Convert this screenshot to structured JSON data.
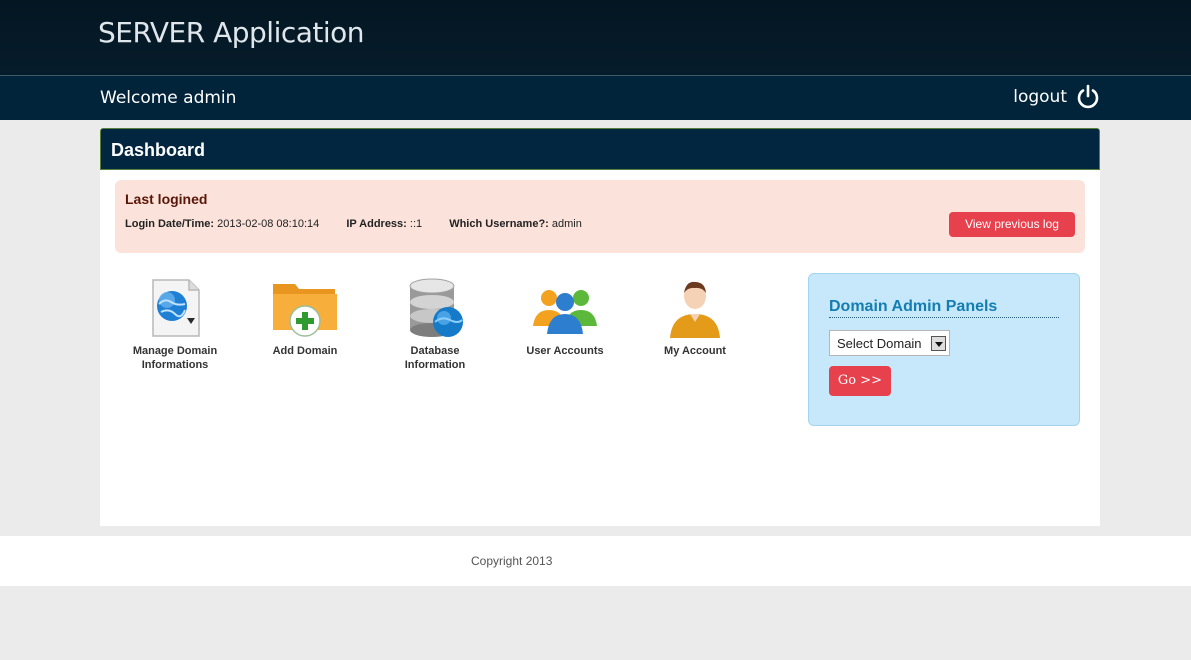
{
  "header": {
    "app_title": "SERVER Application"
  },
  "userbar": {
    "welcome": "Welcome admin",
    "logout_label": "logout",
    "logout_icon": "power-icon"
  },
  "dashboard": {
    "title": "Dashboard",
    "last_login": {
      "title": "Last logined",
      "date_label": "Login Date/Time:",
      "date_value": "2013-02-08 08:10:14",
      "ip_label": "IP Address:",
      "ip_value": "::1",
      "user_label": "Which Username?:",
      "user_value": "admin",
      "view_log_button": "View previous log"
    },
    "tiles": [
      {
        "label_line1": "Manage Domain",
        "label_line2": "Informations",
        "icon": "globe-document-icon"
      },
      {
        "label_line1": "Add Domain",
        "label_line2": "",
        "icon": "folder-add-icon"
      },
      {
        "label_line1": "Database",
        "label_line2": "Information",
        "icon": "database-globe-icon"
      },
      {
        "label_line1": "User Accounts",
        "label_line2": "",
        "icon": "users-icon"
      },
      {
        "label_line1": "My Account",
        "label_line2": "",
        "icon": "user-icon"
      }
    ],
    "domain_panel": {
      "title": "Domain Admin Panels",
      "select_value": "Select Domain",
      "go_button": "Go >>"
    }
  },
  "footer": {
    "copyright": "Copyright 2013"
  },
  "colors": {
    "header_bg": "#041622",
    "userbar_bg": "#02243a",
    "panel_head_bg": "#022640",
    "login_box_bg": "#fbe3db",
    "accent_red": "#e8414e",
    "domain_panel_bg": "#c6e8fa",
    "domain_title": "#147db2"
  }
}
